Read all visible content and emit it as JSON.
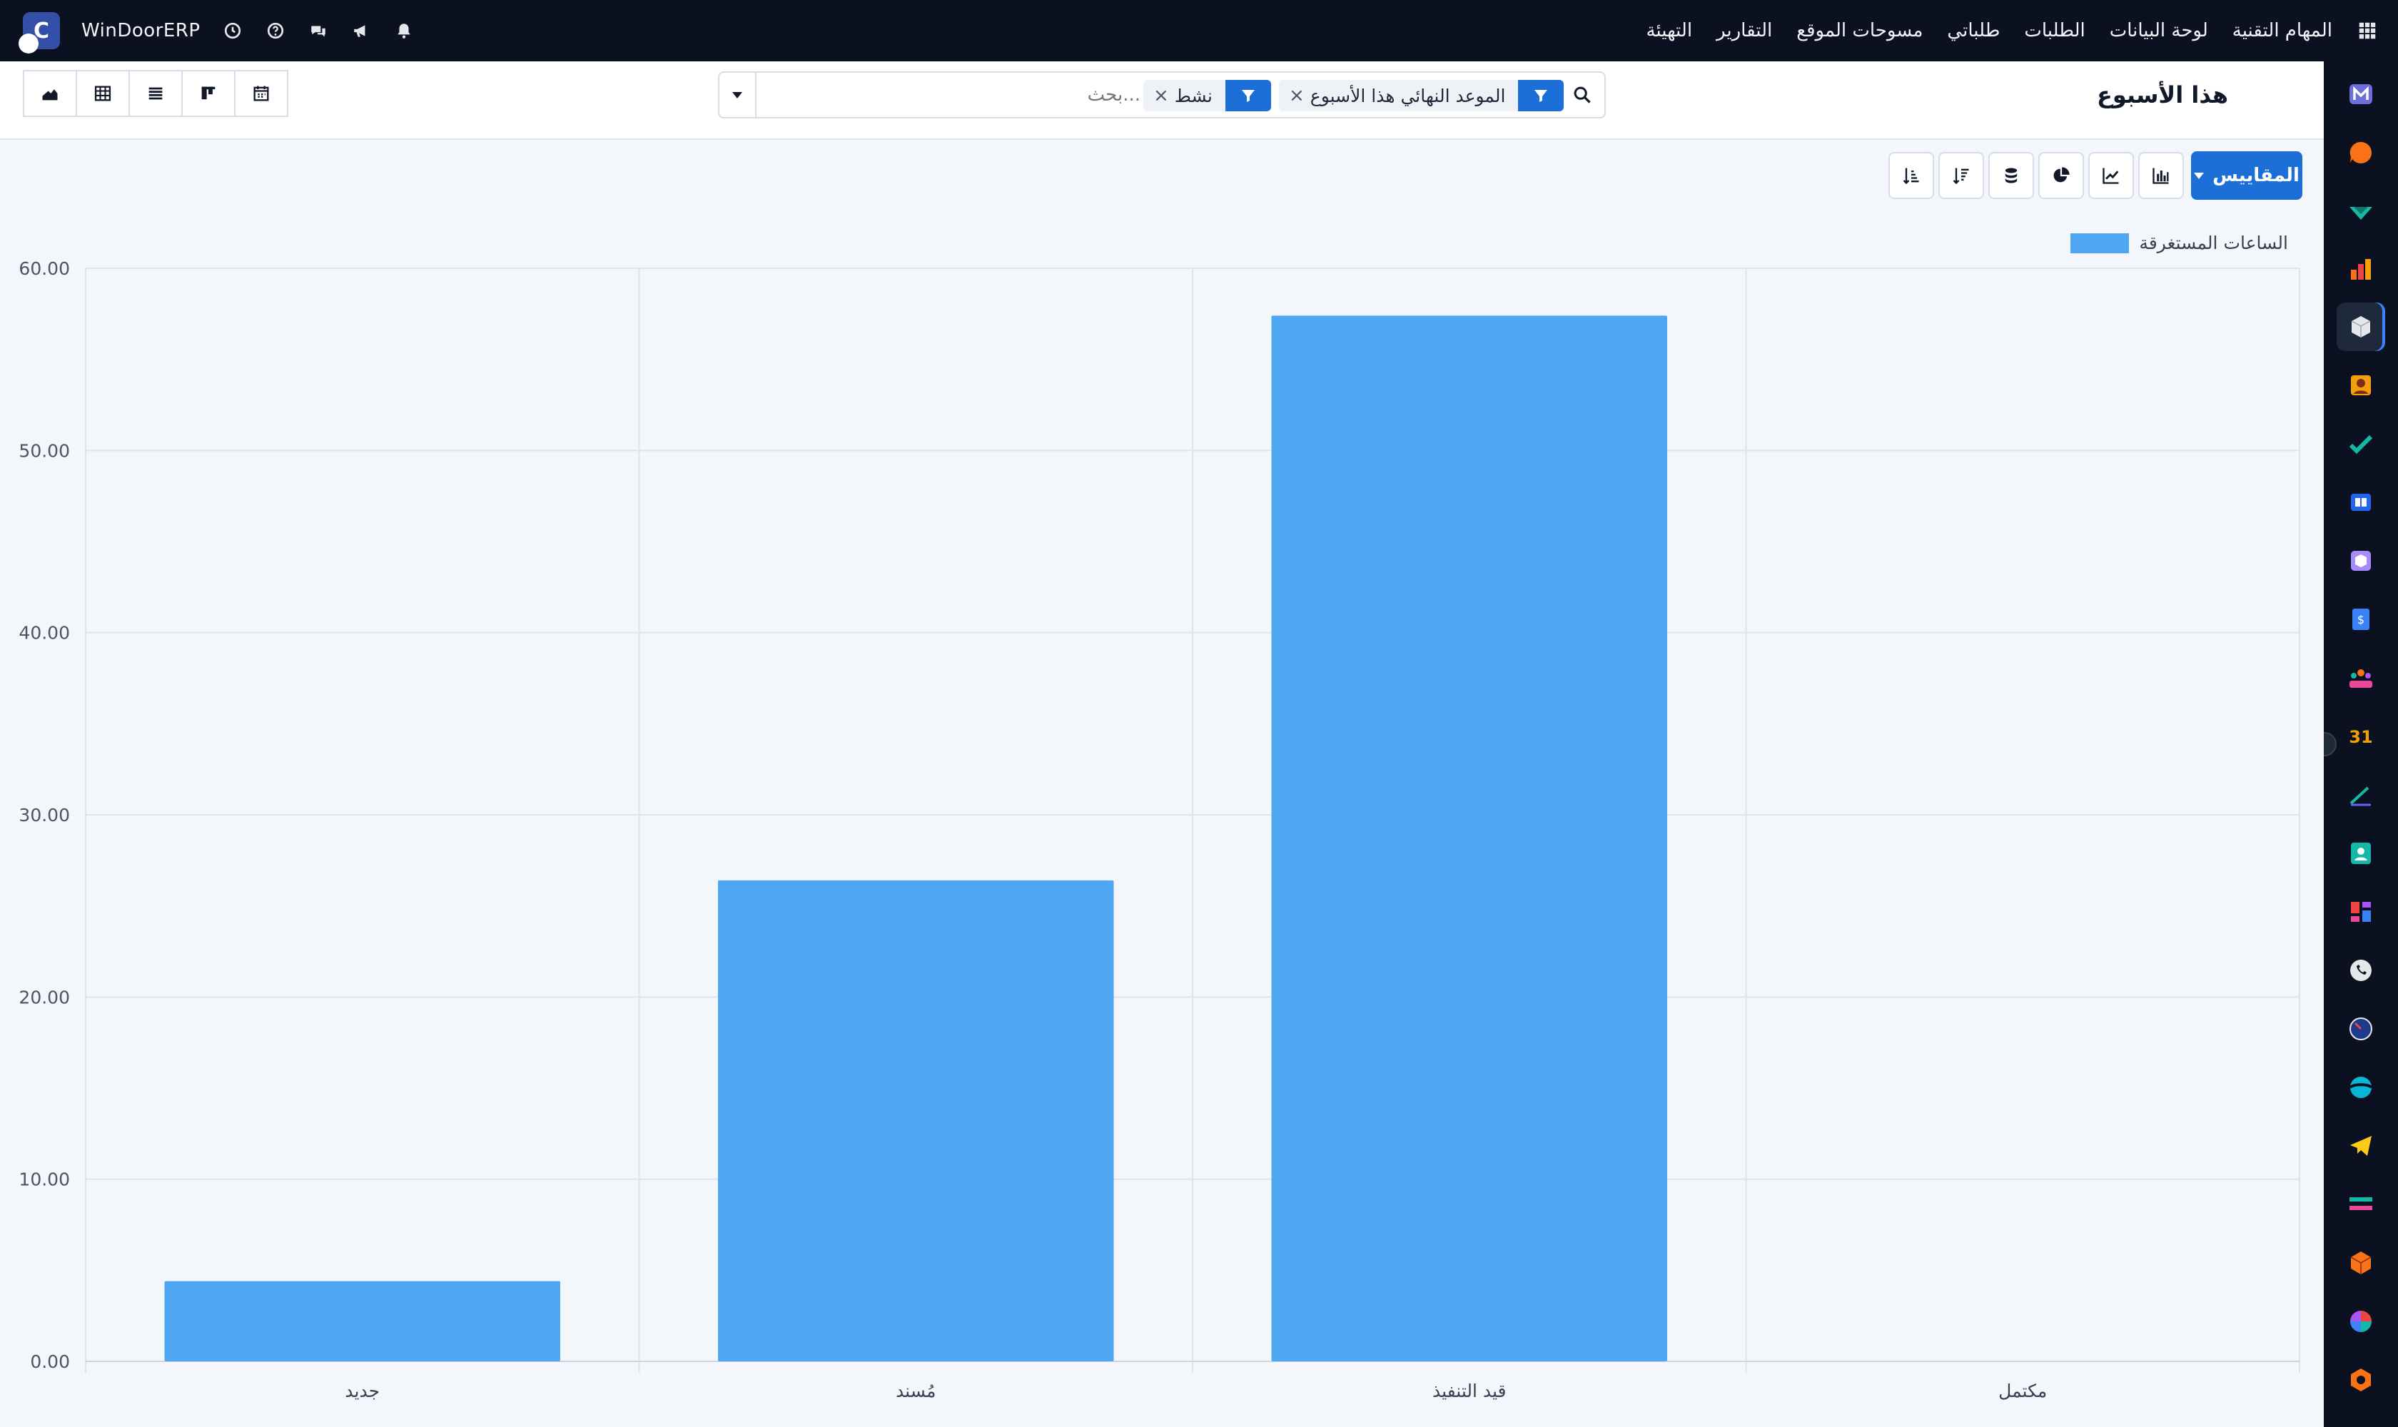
{
  "topbar": {
    "brand": "WinDoorERP",
    "logo_letter": "C",
    "menu": [
      "المهام التقنية",
      "لوحة البيانات",
      "الطلبات",
      "طلباتي",
      "مسوحات الموقع",
      "التقارير",
      "التهيئة"
    ]
  },
  "control": {
    "title": "هذا الأسبوع",
    "search_placeholder": "بحث...",
    "facets": [
      "الموعد النهائي هذا الأسبوع",
      "نشط"
    ],
    "facet_close": "×"
  },
  "toolbar": {
    "measures_label": "المقاييس"
  },
  "legend": {
    "label": "الساعات المستغرقة",
    "color": "#4fa6f1"
  },
  "chart_data": {
    "type": "bar",
    "categories": [
      "جديد",
      "مُسند",
      "قيد التنفيذ",
      "مكتمل"
    ],
    "series": [
      {
        "name": "الساعات المستغرقة",
        "values": [
          4.4,
          26.4,
          57.4,
          0
        ]
      }
    ],
    "ylim": [
      0,
      60
    ],
    "yticks": [
      "0.00",
      "10.00",
      "20.00",
      "30.00",
      "40.00",
      "50.00",
      "60.00"
    ],
    "grid": true,
    "legend_position": "top-right",
    "bar_color": "#4fa6f1"
  },
  "sidebar": {
    "apps": [
      "mail-app",
      "discuss-app",
      "approvals-app",
      "reports-app",
      "inventory-app",
      "contacts-app",
      "tasks-app",
      "knowledge-app",
      "products-app",
      "invoicing-app",
      "team-app",
      "calendar-app",
      "sign-app",
      "employees-app",
      "dashboards-app",
      "whatsapp-app",
      "timer-app",
      "crm-app",
      "telegram-app",
      "payroll-app",
      "assets-app",
      "analytics-app",
      "settings-app"
    ],
    "calendar_badge": "31"
  }
}
